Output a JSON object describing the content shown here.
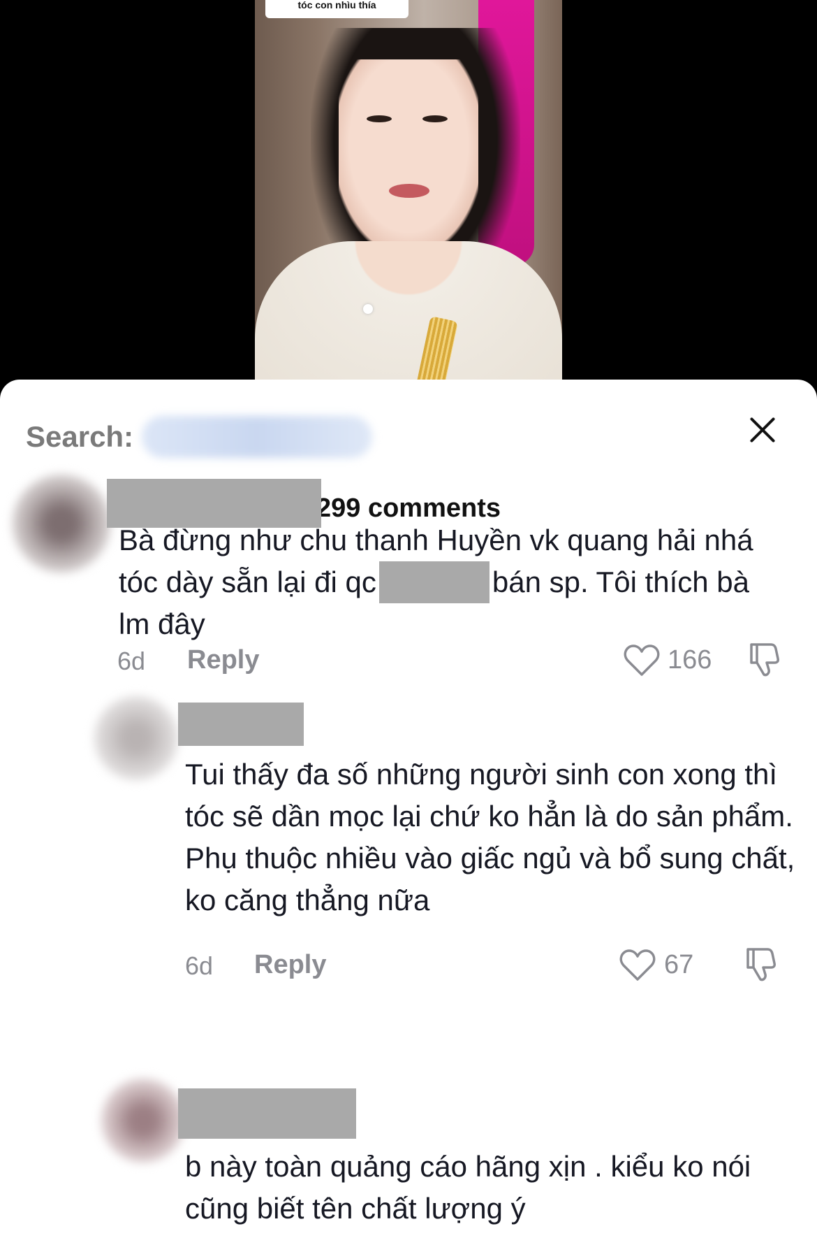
{
  "video": {
    "caption": "tóc con nhìu thía"
  },
  "header": {
    "search_label": "Search:",
    "comment_count": "299 comments"
  },
  "comments": [
    {
      "text_part1": "Bà đừng như chu thanh Huyền vk quang hải nhá tóc dày sẵn lại đi qc",
      "text_part2": "bán sp. Tôi thích bà lm đây",
      "time": "6d",
      "reply_label": "Reply",
      "likes": "166"
    },
    {
      "text": "Tui thấy đa số những người sinh con xong thì tóc sẽ dần mọc lại chứ ko hẳn là do sản phẩm. Phụ thuộc nhiều vào giấc ngủ và bổ sung chất, ko căng thẳng nữa",
      "time": "6d",
      "reply_label": "Reply",
      "likes": "67"
    },
    {
      "text": "b này toàn quảng cáo hãng xịn . kiểu ko nói cũng biết tên chất lượng ý"
    }
  ],
  "colors": {
    "sheet_background": "#ffffff",
    "redaction": "#a9a9a9",
    "meta_text": "#8a8b91"
  }
}
